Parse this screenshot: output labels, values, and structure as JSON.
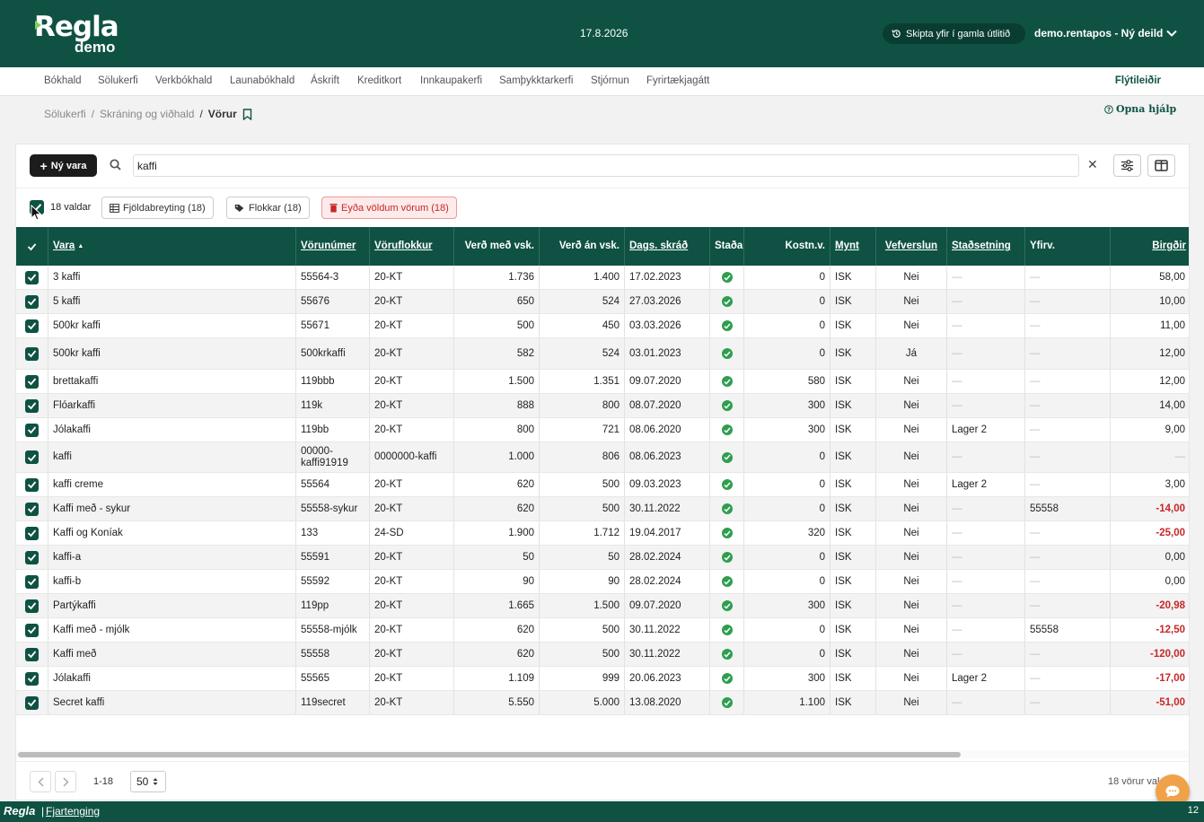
{
  "header": {
    "logo_text": "Regla",
    "logo_sub": "demo",
    "date": "17.8.2026",
    "legacy_button": "Skipta yfir í gamla útlitið",
    "company": "demo.rentapos - Ný deild"
  },
  "nav": {
    "items": [
      "Bókhald",
      "Sölukerfi",
      "Verkbókhald",
      "Launabókhald",
      "Áskrift",
      "Kreditkort",
      "Innkaupakerfi",
      "Samþykktarkerfi",
      "Stjórnun",
      "Fyrirtækjagátt"
    ],
    "shortcuts": "Flýtileiðir"
  },
  "breadcrumb": {
    "items": [
      "Sölukerfi",
      "Skráning og viðhald",
      "Vörur"
    ],
    "help": "Opna hjálp"
  },
  "toolbar": {
    "new_button": "Ný vara",
    "search_value": "kaffi"
  },
  "bulk": {
    "selected": "18 valdar",
    "bulk_edit": "Fjöldabreyting (18)",
    "categories": "Flokkar (18)",
    "delete": "Eyða völdum vörum (18)"
  },
  "table": {
    "columns": [
      "Vara",
      "Vörunúmer",
      "Vöruflokkur",
      "Verð með vsk.",
      "Verð án vsk.",
      "Dags. skráð",
      "Staða",
      "Kostn.v.",
      "Mynt",
      "Vefverslun",
      "Staðsetning",
      "Yfirv.",
      "Birgðir"
    ],
    "sort_indicator": "▲",
    "dash": "—",
    "rows": [
      {
        "name": "3 kaffi",
        "sku": "55564-3",
        "cat": "20-KT",
        "price_vat": "1.736",
        "price": "1.400",
        "date": "17.02.2023",
        "cost": "0",
        "cur": "ISK",
        "web": "Nei",
        "loc": "",
        "parent": "",
        "stock": "58,00",
        "neg": false
      },
      {
        "name": "5 kaffi",
        "sku": "55676",
        "cat": "20-KT",
        "price_vat": "650",
        "price": "524",
        "date": "27.03.2026",
        "cost": "0",
        "cur": "ISK",
        "web": "Nei",
        "loc": "",
        "parent": "",
        "stock": "10,00",
        "neg": false
      },
      {
        "name": "500kr kaffi",
        "sku": "55671",
        "cat": "20-KT",
        "price_vat": "500",
        "price": "450",
        "date": "03.03.2026",
        "cost": "0",
        "cur": "ISK",
        "web": "Nei",
        "loc": "",
        "parent": "",
        "stock": "11,00",
        "neg": false
      },
      {
        "name": "500kr kaffi",
        "sku": "500krkaffi",
        "cat": "20-KT",
        "price_vat": "582",
        "price": "524",
        "date": "03.01.2023",
        "cost": "0",
        "cur": "ISK",
        "web": "Já",
        "loc": "",
        "parent": "",
        "stock": "12,00",
        "neg": false
      },
      {
        "name": "brettakaffi",
        "sku": "119bbb",
        "cat": "20-KT",
        "price_vat": "1.500",
        "price": "1.351",
        "date": "09.07.2020",
        "cost": "580",
        "cur": "ISK",
        "web": "Nei",
        "loc": "",
        "parent": "",
        "stock": "12,00",
        "neg": false
      },
      {
        "name": "Flóarkaffi",
        "sku": "119k",
        "cat": "20-KT",
        "price_vat": "888",
        "price": "800",
        "date": "08.07.2020",
        "cost": "300",
        "cur": "ISK",
        "web": "Nei",
        "loc": "",
        "parent": "",
        "stock": "14,00",
        "neg": false
      },
      {
        "name": "Jólakaffi",
        "sku": "119bb",
        "cat": "20-KT",
        "price_vat": "800",
        "price": "721",
        "date": "08.06.2020",
        "cost": "300",
        "cur": "ISK",
        "web": "Nei",
        "loc": "Lager 2",
        "parent": "",
        "stock": "9,00",
        "neg": false
      },
      {
        "name": "kaffi",
        "sku": "00000-kaffi91919",
        "cat": "0000000-kaffi",
        "price_vat": "1.000",
        "price": "806",
        "date": "08.06.2023",
        "cost": "0",
        "cur": "ISK",
        "web": "Nei",
        "loc": "",
        "parent": "",
        "stock": "",
        "neg": false
      },
      {
        "name": "kaffi creme",
        "sku": "55564",
        "cat": "20-KT",
        "price_vat": "620",
        "price": "500",
        "date": "09.03.2023",
        "cost": "0",
        "cur": "ISK",
        "web": "Nei",
        "loc": "Lager 2",
        "parent": "",
        "stock": "3,00",
        "neg": false
      },
      {
        "name": "Kaffi með - sykur",
        "sku": "55558-sykur",
        "cat": "20-KT",
        "price_vat": "620",
        "price": "500",
        "date": "30.11.2022",
        "cost": "0",
        "cur": "ISK",
        "web": "Nei",
        "loc": "",
        "parent": "55558",
        "stock": "-14,00",
        "neg": true
      },
      {
        "name": "Kaffi og Koníak",
        "sku": "133",
        "cat": "24-SD",
        "price_vat": "1.900",
        "price": "1.712",
        "date": "19.04.2017",
        "cost": "320",
        "cur": "ISK",
        "web": "Nei",
        "loc": "",
        "parent": "",
        "stock": "-25,00",
        "neg": true
      },
      {
        "name": "kaffi-a",
        "sku": "55591",
        "cat": "20-KT",
        "price_vat": "50",
        "price": "50",
        "date": "28.02.2024",
        "cost": "0",
        "cur": "ISK",
        "web": "Nei",
        "loc": "",
        "parent": "",
        "stock": "0,00",
        "neg": false
      },
      {
        "name": "kaffi-b",
        "sku": "55592",
        "cat": "20-KT",
        "price_vat": "90",
        "price": "90",
        "date": "28.02.2024",
        "cost": "0",
        "cur": "ISK",
        "web": "Nei",
        "loc": "",
        "parent": "",
        "stock": "0,00",
        "neg": false
      },
      {
        "name": "Partýkaffi",
        "sku": "119pp",
        "cat": "20-KT",
        "price_vat": "1.665",
        "price": "1.500",
        "date": "09.07.2020",
        "cost": "300",
        "cur": "ISK",
        "web": "Nei",
        "loc": "",
        "parent": "",
        "stock": "-20,98",
        "neg": true
      },
      {
        "name": "Kaffi með - mjólk",
        "sku": "55558-mjólk",
        "cat": "20-KT",
        "price_vat": "620",
        "price": "500",
        "date": "30.11.2022",
        "cost": "0",
        "cur": "ISK",
        "web": "Nei",
        "loc": "",
        "parent": "55558",
        "stock": "-12,50",
        "neg": true
      },
      {
        "name": "Kaffi með",
        "sku": "55558",
        "cat": "20-KT",
        "price_vat": "620",
        "price": "500",
        "date": "30.11.2022",
        "cost": "0",
        "cur": "ISK",
        "web": "Nei",
        "loc": "",
        "parent": "",
        "stock": "-120,00",
        "neg": true
      },
      {
        "name": "Jólakaffi",
        "sku": "55565",
        "cat": "20-KT",
        "price_vat": "1.109",
        "price": "999",
        "date": "20.06.2023",
        "cost": "300",
        "cur": "ISK",
        "web": "Nei",
        "loc": "Lager 2",
        "parent": "",
        "stock": "-17,00",
        "neg": true
      },
      {
        "name": "Secret kaffi",
        "sku": "119secret",
        "cat": "20-KT",
        "price_vat": "5.550",
        "price": "5.000",
        "date": "13.08.2020",
        "cost": "1.100",
        "cur": "ISK",
        "web": "Nei",
        "loc": "",
        "parent": "",
        "stock": "-51,00",
        "neg": true
      }
    ]
  },
  "pagination": {
    "range": "1-18",
    "page_size": "50",
    "total": "18 vörur val"
  },
  "statusbar": {
    "logo": "Regla",
    "remote": "Fjartenging",
    "number": "12"
  },
  "colors": {
    "brand": "#0f5243",
    "danger": "#c62828",
    "ok": "#2e9e4f"
  }
}
